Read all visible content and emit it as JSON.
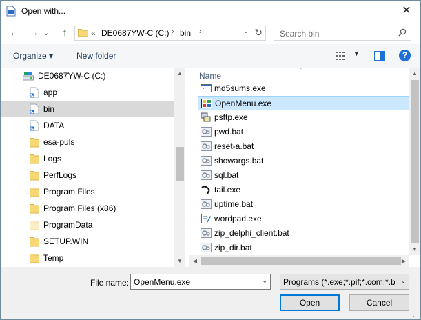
{
  "window": {
    "title": "Open with...",
    "close_glyph": "✕"
  },
  "navigation": {
    "back_glyph": "←",
    "forward_glyph": "→",
    "recent_glyph": "⌄",
    "up_glyph": "↑",
    "breadcrumb_overflow": "«",
    "breadcrumbs": [
      "DE0687YW-C (C:)",
      "bin"
    ],
    "breadcrumb_sep": "›",
    "dropdown_glyph": "⌄",
    "refresh_glyph": "↻",
    "search_placeholder": "Search bin"
  },
  "toolbar": {
    "organize_label": "Organize ▾",
    "new_folder_label": "New folder",
    "view_caret": "▼",
    "help_label": "?"
  },
  "tree": {
    "drive_label": "DE0687YW-C (C:)",
    "items": [
      {
        "label": "app",
        "type": "shortcut",
        "selected": false
      },
      {
        "label": "bin",
        "type": "shortcut",
        "selected": true
      },
      {
        "label": "DATA",
        "type": "shortcut",
        "selected": false
      },
      {
        "label": "esa-puls",
        "type": "folder",
        "selected": false
      },
      {
        "label": "Logs",
        "type": "folder",
        "selected": false
      },
      {
        "label": "PerfLogs",
        "type": "folder",
        "selected": false
      },
      {
        "label": "Program Files",
        "type": "folder",
        "selected": false
      },
      {
        "label": "Program Files (x86)",
        "type": "folder",
        "selected": false
      },
      {
        "label": "ProgramData",
        "type": "folder-hidden",
        "selected": false
      },
      {
        "label": "SETUP.WIN",
        "type": "folder",
        "selected": false
      },
      {
        "label": "Temp",
        "type": "folder",
        "selected": false
      }
    ]
  },
  "files": {
    "column_name": "Name",
    "sort_caret": "^",
    "items": [
      {
        "label": "md5sums.exe",
        "icon": "exe-window-icon",
        "selected": false
      },
      {
        "label": "OpenMenu.exe",
        "icon": "openmenu-app-icon",
        "selected": true
      },
      {
        "label": "psftp.exe",
        "icon": "psftp-icon",
        "selected": false
      },
      {
        "label": "pwd.bat",
        "icon": "batch-file-icon",
        "selected": false
      },
      {
        "label": "reset-a.bat",
        "icon": "batch-file-icon",
        "selected": false
      },
      {
        "label": "showargs.bat",
        "icon": "batch-file-icon",
        "selected": false
      },
      {
        "label": "sql.bat",
        "icon": "batch-file-icon",
        "selected": false
      },
      {
        "label": "tail.exe",
        "icon": "tail-app-icon",
        "selected": false
      },
      {
        "label": "uptime.bat",
        "icon": "batch-file-icon",
        "selected": false
      },
      {
        "label": "wordpad.exe",
        "icon": "wordpad-icon",
        "selected": false
      },
      {
        "label": "zip_delphi_client.bat",
        "icon": "batch-file-icon",
        "selected": false
      },
      {
        "label": "zip_dir.bat",
        "icon": "batch-file-icon",
        "selected": false
      }
    ]
  },
  "scroll": {
    "up_glyph": "▲",
    "down_glyph": "▼",
    "left_glyph": "◀",
    "right_glyph": "▶"
  },
  "footer": {
    "file_name_label": "File name:",
    "file_name_value": "OpenMenu.exe",
    "file_name_dropdown": "⌄",
    "filter_value": "Programs (*.exe;*.pif;*.com;*.bat;*.cmd)",
    "filter_dropdown": "⌄",
    "open_label": "Open",
    "cancel_label": "Cancel",
    "grip_glyph": "⋰"
  },
  "colors": {
    "selection_bg": "#cce8ff",
    "selection_border": "#99d1ff",
    "tree_selection": "#d9d9d9",
    "folder_yellow": "#f8d775",
    "accent": "#0078d7"
  }
}
